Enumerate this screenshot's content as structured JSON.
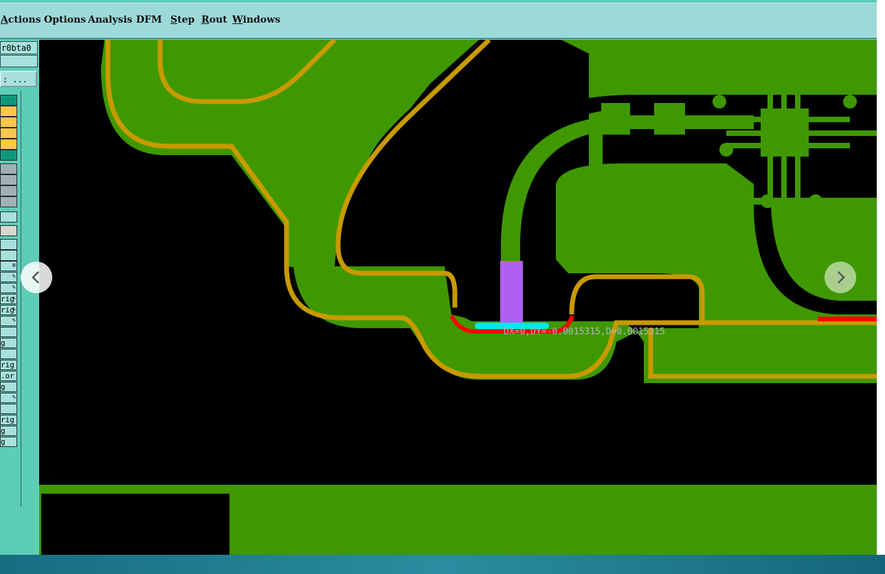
{
  "menubar": {
    "items": [
      {
        "label": "Actions",
        "underline": "A",
        "rest": "ctions"
      },
      {
        "label": "Options"
      },
      {
        "label": "Analysis"
      },
      {
        "label": "DFM"
      },
      {
        "label": "Step",
        "underline": "S",
        "rest": "tep"
      },
      {
        "label": "Rout",
        "underline": "R",
        "rest": "out"
      },
      {
        "label": "Windows",
        "underline": "W",
        "rest": "indows"
      }
    ]
  },
  "left_panel": {
    "layer_field": "r0bta0",
    "browse_button": ": ...",
    "colors": {
      "teal_active": "#0e9a7a",
      "orange": "#ffc64a",
      "grey": "#a0b0b4",
      "light": "#a8e0dc",
      "pale": "#d8d8d0"
    },
    "labels": [
      "rig",
      "rig",
      "g",
      "rig",
      ".or",
      "g",
      "rig",
      "g",
      "g"
    ]
  },
  "canvas": {
    "background": "#000000",
    "copper_color": "#3f9800",
    "outline_color": "#c89a00",
    "highlight_red": "#ff0000",
    "highlight_cyan": "#00e8f0",
    "pad_purple": "#b060f0",
    "measurement_text": "DX=0,DY=-0.0015315,D=0.0015315"
  },
  "nav": {
    "prev_icon": "chevron-left-icon",
    "next_icon": "chevron-right-icon"
  }
}
